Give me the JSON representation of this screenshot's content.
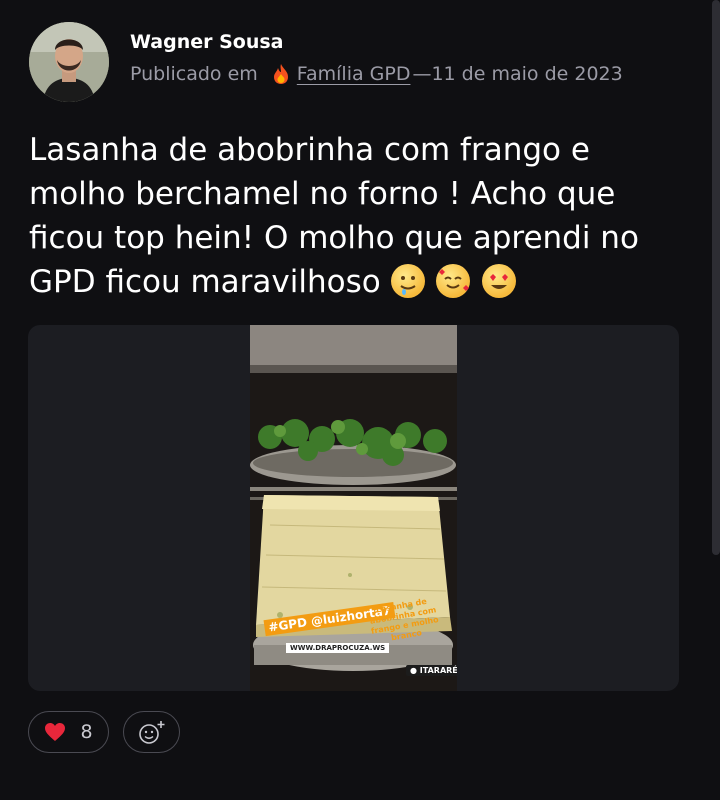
{
  "post": {
    "author": "Wagner Sousa",
    "published_prefix": "Publicado em",
    "community": "Família GPD",
    "date_separator": "—",
    "date": "11 de maio de 2023",
    "text": "Lasanha de abobrinha com frango e molho berchamel no forno ! Acho que ficou top hein! O molho que aprendi no GPD ficou maravilhoso",
    "emojis": [
      "drooling-face",
      "smiling-face-with-hearts",
      "heart-eyes-face"
    ]
  },
  "photo": {
    "sticker_handle": "#GPD @luizhorta7",
    "sticker_caption": "Lasanha de abobrinha com frango e molho branco",
    "sticker_site": "WWW.DRAPROCUZA.WS",
    "location": "ITARARÉ"
  },
  "reactions": {
    "like_count": "8",
    "like_icon": "heart-icon",
    "add_icon": "add-reaction-icon"
  },
  "colors": {
    "background": "#0f0f12",
    "media_background": "#1c1d22",
    "muted_text": "#9b9ba6",
    "heart": "#e8273b"
  }
}
